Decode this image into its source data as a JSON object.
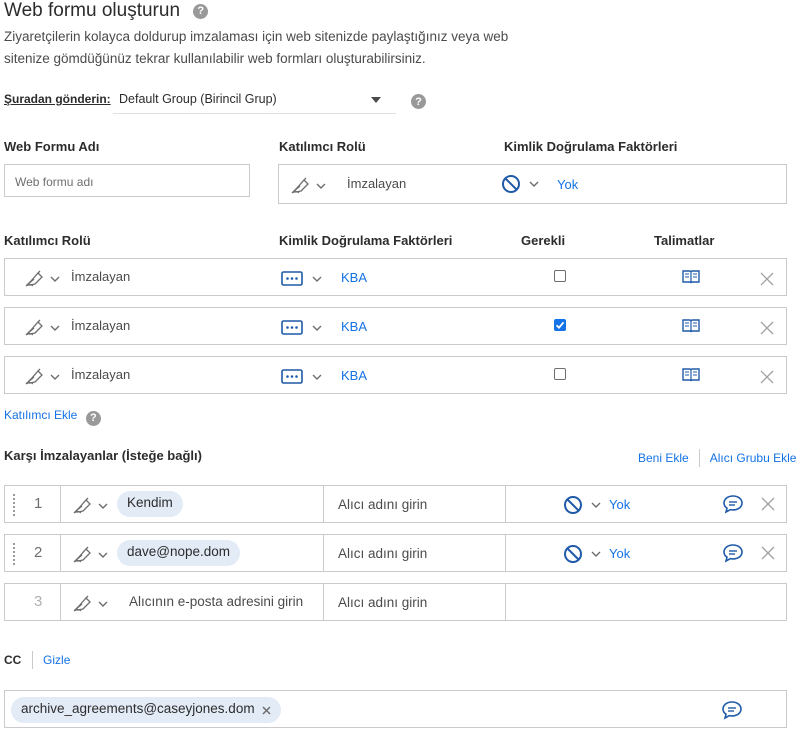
{
  "header": {
    "title": "Web formu oluşturun",
    "description": "Ziyaretçilerin kolayca doldurup imzalaması için web sitenizde paylaştığınız veya web sitenize gömdüğünüz tekrar kullanılabilir web formları oluşturabilirsiniz."
  },
  "send_from": {
    "label": "Şuradan gönderin:",
    "value": "Default Group (Birincil Grup)"
  },
  "form": {
    "name_label": "Web Formu Adı",
    "name_placeholder": "Web formu adı",
    "role_label": "Katılımcı Rolü",
    "auth_label": "Kimlik Doğrulama Faktörleri",
    "role_value": "İmzalayan",
    "auth_value": "Yok"
  },
  "participants": {
    "headers": {
      "role": "Katılımcı Rolü",
      "auth": "Kimlik Doğrulama Faktörleri",
      "required": "Gerekli",
      "instructions": "Talimatlar"
    },
    "rows": [
      {
        "role": "İmzalayan",
        "auth": "KBA",
        "required": false
      },
      {
        "role": "İmzalayan",
        "auth": "KBA",
        "required": true
      },
      {
        "role": "İmzalayan",
        "auth": "KBA",
        "required": false
      }
    ],
    "add_label": "Katılımcı Ekle"
  },
  "countersigners": {
    "title": "Karşı İmzalayanlar (İsteğe bağlı)",
    "add_me": "Beni Ekle",
    "add_group": "Alıcı Grubu Ekle",
    "rows": [
      {
        "num": "1",
        "recipient": "Kendim",
        "name_placeholder": "Alıcı adını girin",
        "auth": "Yok"
      },
      {
        "num": "2",
        "recipient": "dave@nope.dom",
        "name_placeholder": "Alıcı adını girin",
        "auth": "Yok"
      },
      {
        "num": "3",
        "recipient_placeholder": "Alıcının e-posta adresini girin",
        "name_placeholder": "Alıcı adını girin"
      }
    ]
  },
  "cc": {
    "label": "CC",
    "hide_label": "Gizle",
    "chip": "archive_agreements@caseyjones.dom"
  },
  "colors": {
    "accent": "#1473e6",
    "border": "#cacaca",
    "chip": "#e3ebf6"
  }
}
